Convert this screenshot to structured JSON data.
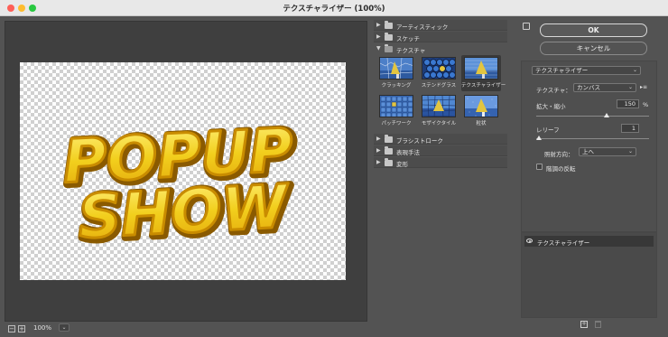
{
  "window": {
    "title": "テクスチャライザー (100%)"
  },
  "preview": {
    "text_line1": "POPUP",
    "text_line2": "SHOW"
  },
  "zoom": {
    "minus": "−",
    "plus": "+",
    "value": "100%",
    "dropdown": "⌄"
  },
  "browser": {
    "categories": [
      {
        "label": "アーティスティック",
        "expanded": false
      },
      {
        "label": "スケッチ",
        "expanded": false
      },
      {
        "label": "テクスチャ",
        "expanded": true
      },
      {
        "label": "ブラシストローク",
        "expanded": false
      },
      {
        "label": "表現手法",
        "expanded": false
      },
      {
        "label": "変形",
        "expanded": false
      }
    ],
    "expand_icon": "▼",
    "collapse_icon": "▶",
    "thumbnails": [
      {
        "label": "クラッキング",
        "selected": false,
        "icon": "cracking-thumbnail"
      },
      {
        "label": "ステンドグラス",
        "selected": false,
        "icon": "stained-glass-thumbnail"
      },
      {
        "label": "テクスチャライザー",
        "selected": true,
        "icon": "texturizer-thumbnail"
      },
      {
        "label": "パッチワーク",
        "selected": false,
        "icon": "patchwork-thumbnail"
      },
      {
        "label": "モザイクタイル",
        "selected": false,
        "icon": "mosaic-tile-thumbnail"
      },
      {
        "label": "粒状",
        "selected": false,
        "icon": "grain-thumbnail"
      }
    ]
  },
  "buttons": {
    "ok": "OK",
    "cancel": "キャンセル"
  },
  "settings": {
    "filter_select": "テクスチャライザー",
    "texture_label": "テクスチャ：",
    "texture_value": "カンバス",
    "scaling_label": "拡大・縮小",
    "scaling_value": "150",
    "scaling_unit": "%",
    "scaling_fraction": 0.625,
    "relief_label": "レリーフ",
    "relief_value": "1",
    "relief_fraction": 0.02,
    "light_label": "照射方向：",
    "light_value": "上へ",
    "invert_label": "階調の反転",
    "invert_checked": false,
    "chevron": "⌄",
    "menu_icon": "▸≡"
  },
  "layers": {
    "items": [
      {
        "label": "テクスチャライザー",
        "visible": true
      }
    ]
  },
  "colors": {
    "pop_yellow": "#f2cf1d",
    "pop_outline": "#b07a00",
    "selected_bg": "#3a3a3a"
  }
}
